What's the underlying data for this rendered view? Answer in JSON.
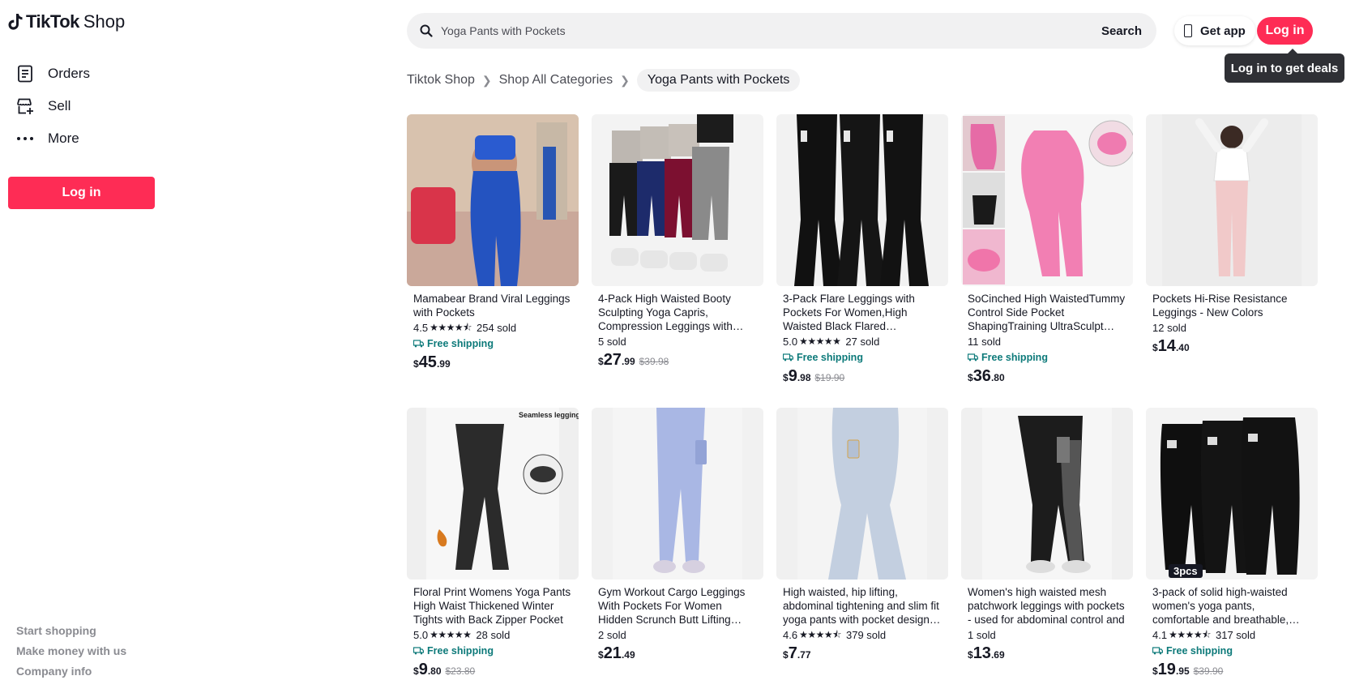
{
  "sidebar": {
    "logo_main": "TikTok",
    "logo_sub": "Shop",
    "items": [
      {
        "label": "Orders"
      },
      {
        "label": "Sell"
      },
      {
        "label": "More"
      }
    ],
    "login_label": "Log in",
    "footer": [
      "Start shopping",
      "Make money with us",
      "Company info"
    ]
  },
  "header": {
    "search_placeholder": "Yoga Pants with Pockets",
    "search_button": "Search",
    "get_app": "Get app",
    "login": "Log in",
    "tooltip": "Log in to get deals"
  },
  "breadcrumb": [
    "Tiktok Shop",
    "Shop All Categories",
    "Yoga Pants with Pockets"
  ],
  "colors": {
    "brand": "#fe2c55",
    "free_shipping": "#0d7a7a"
  },
  "products": [
    {
      "title": "Mamabear Brand Viral Leggings with Pockets",
      "rating": "4.5",
      "stars": "★★★★⯪",
      "sold": "254 sold",
      "free_shipping": "Free shipping",
      "cur": "$",
      "int": "45",
      "dec": ".99",
      "orig": ""
    },
    {
      "title": "4-Pack High Waisted Booty Sculpting Yoga Capris, Compression Leggings with Side Phone Pockets",
      "rating": "",
      "stars": "",
      "sold": "5 sold",
      "free_shipping": "",
      "cur": "$",
      "int": "27",
      "dec": ".99",
      "orig": "$39.98"
    },
    {
      "title": "3-Pack Flare Leggings with Pockets For Women,High Waisted Black Flared Leggings,Flare Pants",
      "rating": "5.0",
      "stars": "★★★★★",
      "sold": "27 sold",
      "free_shipping": "Free shipping",
      "cur": "$",
      "int": "9",
      "dec": ".98",
      "orig": "$19.90"
    },
    {
      "title": "SoCinched High WaistedTummy Control Side Pocket ShapingTraining UltraSculpt Leggings solid",
      "rating": "",
      "stars": "",
      "sold": "11 sold",
      "free_shipping": "Free shipping",
      "cur": "$",
      "int": "36",
      "dec": ".80",
      "orig": ""
    },
    {
      "title": "Pockets Hi-Rise Resistance Leggings - New Colors",
      "rating": "",
      "stars": "",
      "sold": "12 sold",
      "free_shipping": "",
      "cur": "$",
      "int": "14",
      "dec": ".40",
      "orig": ""
    },
    {
      "title": "Floral Print Womens Yoga Pants High Waist Thickened Winter Tights with Back Zipper Pocket",
      "rating": "5.0",
      "stars": "★★★★★",
      "sold": "28 sold",
      "free_shipping": "Free shipping",
      "cur": "$",
      "int": "9",
      "dec": ".80",
      "orig": "$23.80",
      "img_text": "Seamless leggings"
    },
    {
      "title": "Gym Workout Cargo Leggings With Pockets For Women Hidden Scrunch Butt Lifting Compression",
      "rating": "",
      "stars": "",
      "sold": "2 sold",
      "free_shipping": "",
      "cur": "$",
      "int": "21",
      "dec": ".49",
      "orig": ""
    },
    {
      "title": "High waisted, hip lifting, abdominal tightening and slim fit yoga pants with pocket design, comfortable",
      "rating": "4.6",
      "stars": "★★★★⯪",
      "sold": "379 sold",
      "free_shipping": "",
      "cur": "$",
      "int": "7",
      "dec": ".77",
      "orig": ""
    },
    {
      "title": "Women's high waisted mesh patchwork leggings with pockets - used for abdominal control and",
      "rating": "",
      "stars": "",
      "sold": "1 sold",
      "free_shipping": "",
      "cur": "$",
      "int": "13",
      "dec": ".69",
      "orig": ""
    },
    {
      "title": "3-pack of solid high-waisted women's yoga pants, comfortable and breathable, sweat absorbing",
      "rating": "4.1",
      "stars": "★★★★⯪",
      "sold": "317 sold",
      "free_shipping": "Free shipping",
      "cur": "$",
      "int": "19",
      "dec": ".95",
      "orig": "$39.90",
      "img_text": "3pcs"
    }
  ]
}
